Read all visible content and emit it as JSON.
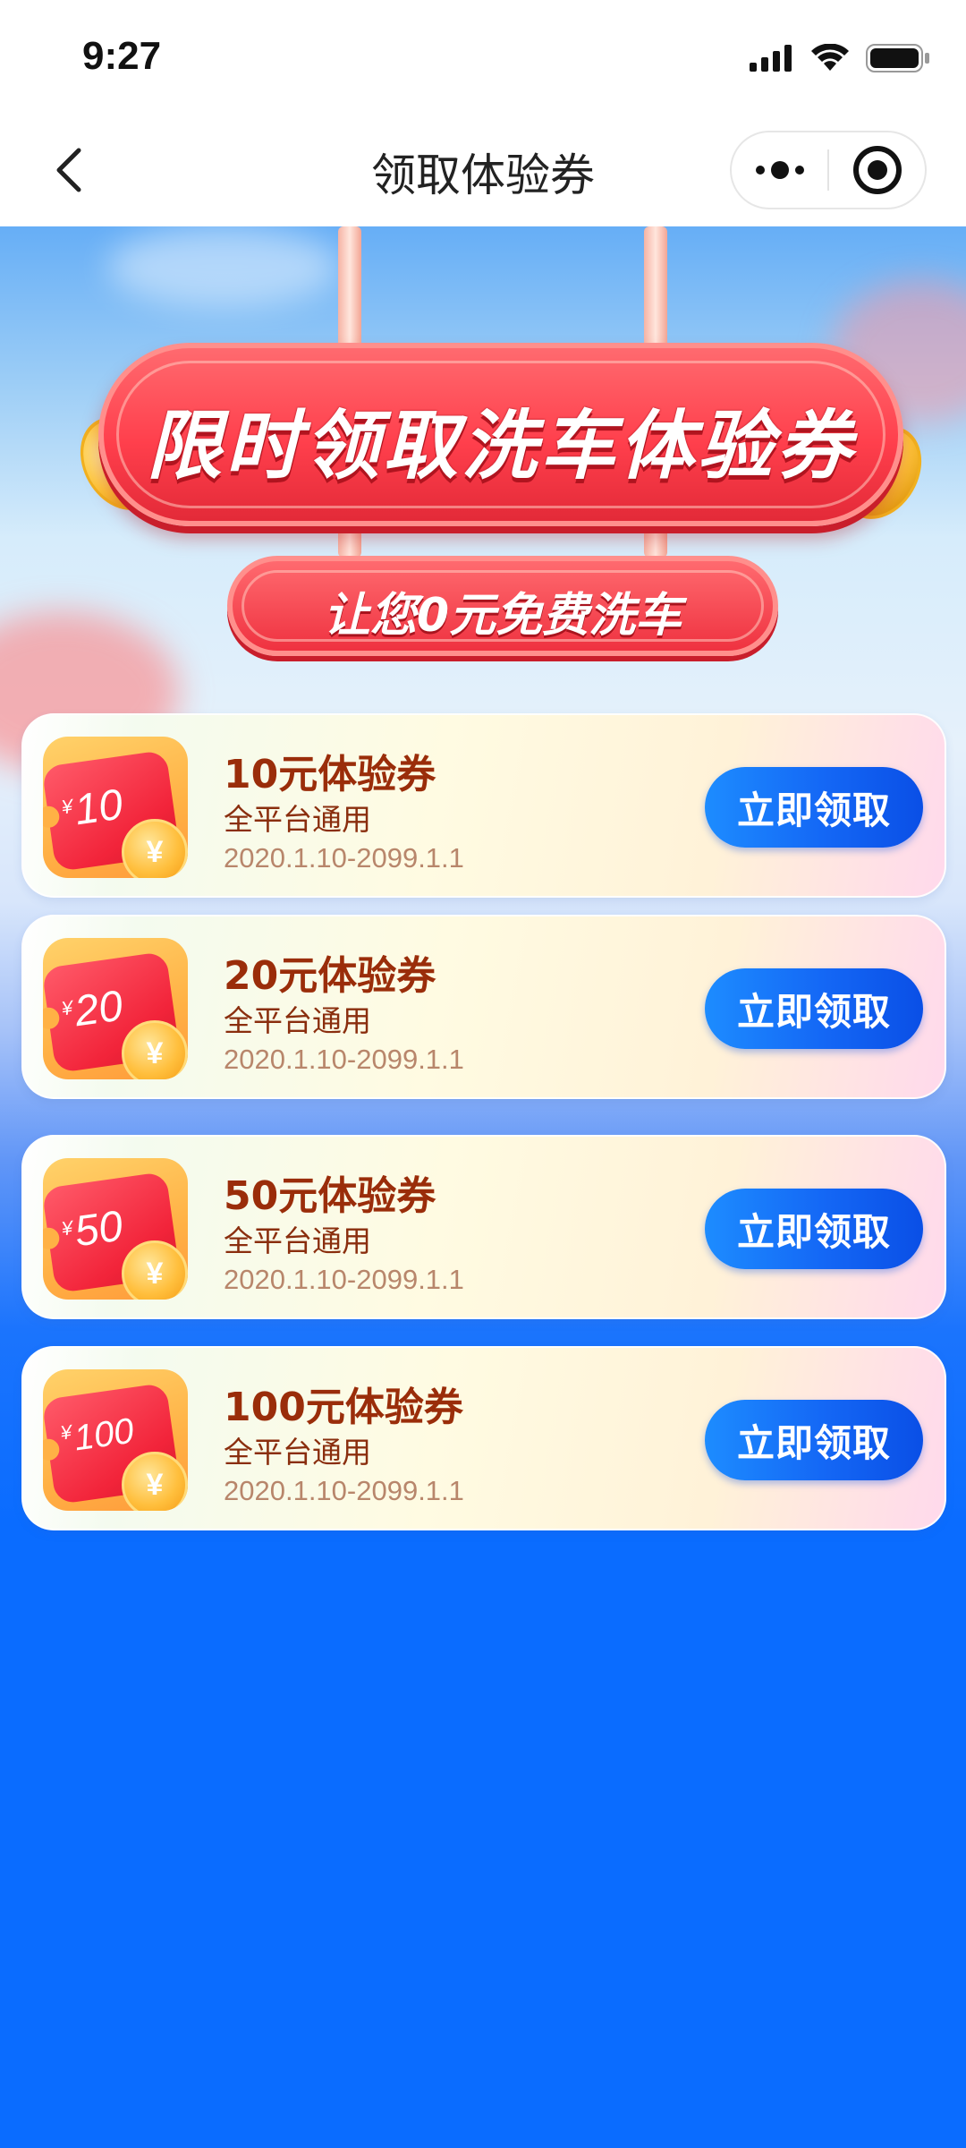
{
  "status_bar": {
    "time": "9:27"
  },
  "nav": {
    "title": "领取体验券"
  },
  "banner": {
    "title": "限时领取洗车体验券",
    "subtitle": "让您0元免费洗车"
  },
  "coupons": [
    {
      "amount": "10",
      "currency_symbol": "¥",
      "title": "10元体验券",
      "desc": "全平台通用",
      "validity": "2020.1.10-2099.1.1",
      "button": "立即领取"
    },
    {
      "amount": "20",
      "currency_symbol": "¥",
      "title": "20元体验券",
      "desc": "全平台通用",
      "validity": "2020.1.10-2099.1.1",
      "button": "立即领取"
    },
    {
      "amount": "50",
      "currency_symbol": "¥",
      "title": "50元体验券",
      "desc": "全平台通用",
      "validity": "2020.1.10-2099.1.1",
      "button": "立即领取"
    },
    {
      "amount": "100",
      "currency_symbol": "¥",
      "title": "100元体验券",
      "desc": "全平台通用",
      "validity": "2020.1.10-2099.1.1",
      "button": "立即领取"
    }
  ],
  "colors": {
    "page_bg": "#0a6cff",
    "banner_red": "#ff3f4c",
    "button_blue": "#1467f5",
    "coupon_title": "#9a2d0a"
  },
  "icons": {
    "back": "chevron-left-icon",
    "more": "more-dots-icon",
    "close": "target-circle-icon",
    "coin": "yen-coin-icon"
  }
}
